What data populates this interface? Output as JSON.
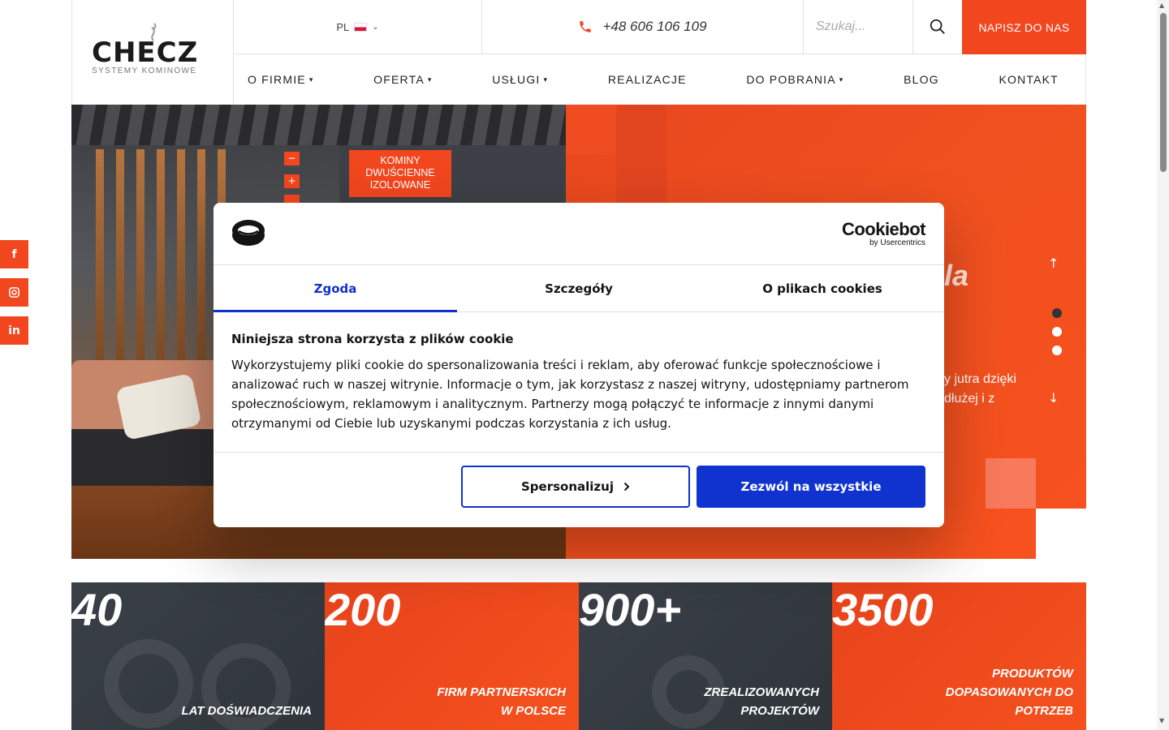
{
  "header": {
    "logo_text": "CHECZ",
    "logo_sub": "SYSTEMY KOMINOWE",
    "lang": "PL",
    "phone": "+48 606 106 109",
    "search_placeholder": "Szukaj...",
    "cta_label": "NAPISZ DO NAS"
  },
  "nav": [
    {
      "label": "O FIRMIE",
      "dropdown": true
    },
    {
      "label": "OFERTA",
      "dropdown": true
    },
    {
      "label": "USŁUGI",
      "dropdown": true
    },
    {
      "label": "REALIZACJE",
      "dropdown": false
    },
    {
      "label": "DO POBRANIA",
      "dropdown": true
    },
    {
      "label": "BLOG",
      "dropdown": false
    },
    {
      "label": "KONTAKT",
      "dropdown": false
    }
  ],
  "hero": {
    "tag_line1": "KOMINY",
    "tag_line2": "DWUŚCIENNE",
    "tag_line3": "IZOLOWANE",
    "title_fragment": "la",
    "text_line1": "y jutra dzięki",
    "text_line2": "dłużej i z",
    "slides": 3,
    "active_slide": 1
  },
  "social": [
    "f",
    "ig",
    "in"
  ],
  "stats": [
    {
      "number": "40",
      "label_line1": "LAT DOŚWIADCZENIA",
      "label_line2": "",
      "label_line3": ""
    },
    {
      "number": "200",
      "label_line1": "FIRM PARTNERSKICH",
      "label_line2": "W POLSCE",
      "label_line3": ""
    },
    {
      "number": "900+",
      "label_line1": "ZREALIZOWANYCH",
      "label_line2": "PROJEKTÓW",
      "label_line3": ""
    },
    {
      "number": "3500",
      "label_line1": "PRODUKTÓW",
      "label_line2": "DOPASOWANYCH DO",
      "label_line3": "POTRZEB"
    }
  ],
  "cookie": {
    "brand": "Cookiebot",
    "brand_sub": "by Usercentrics",
    "tabs": [
      "Zgoda",
      "Szczegóły",
      "O plikach cookies"
    ],
    "title": "Niniejsza strona korzysta z plików cookie",
    "text": "Wykorzystujemy pliki cookie do spersonalizowania treści i reklam, aby oferować funkcje społecznościowe i analizować ruch w naszej witrynie. Informacje o tym, jak korzystasz z naszej witryny, udostępniamy partnerom społecznościowym, reklamowym i analitycznym. Partnerzy mogą połączyć te informacje z innymi danymi otrzymanymi od Ciebie lub uzyskanymi podczas korzystania z ich usług.",
    "btn_customize": "Spersonalizuj",
    "btn_allow": "Zezwól na wszystkie"
  },
  "colors": {
    "accent": "#f2461e",
    "cookie_blue": "#1032cf",
    "dark_tile": "#343a40"
  },
  "icons": {
    "phone": "phone-icon",
    "search": "search-icon",
    "chevron": "chevron-down-icon",
    "facebook": "facebook-icon",
    "instagram": "instagram-icon",
    "linkedin": "linkedin-icon"
  }
}
